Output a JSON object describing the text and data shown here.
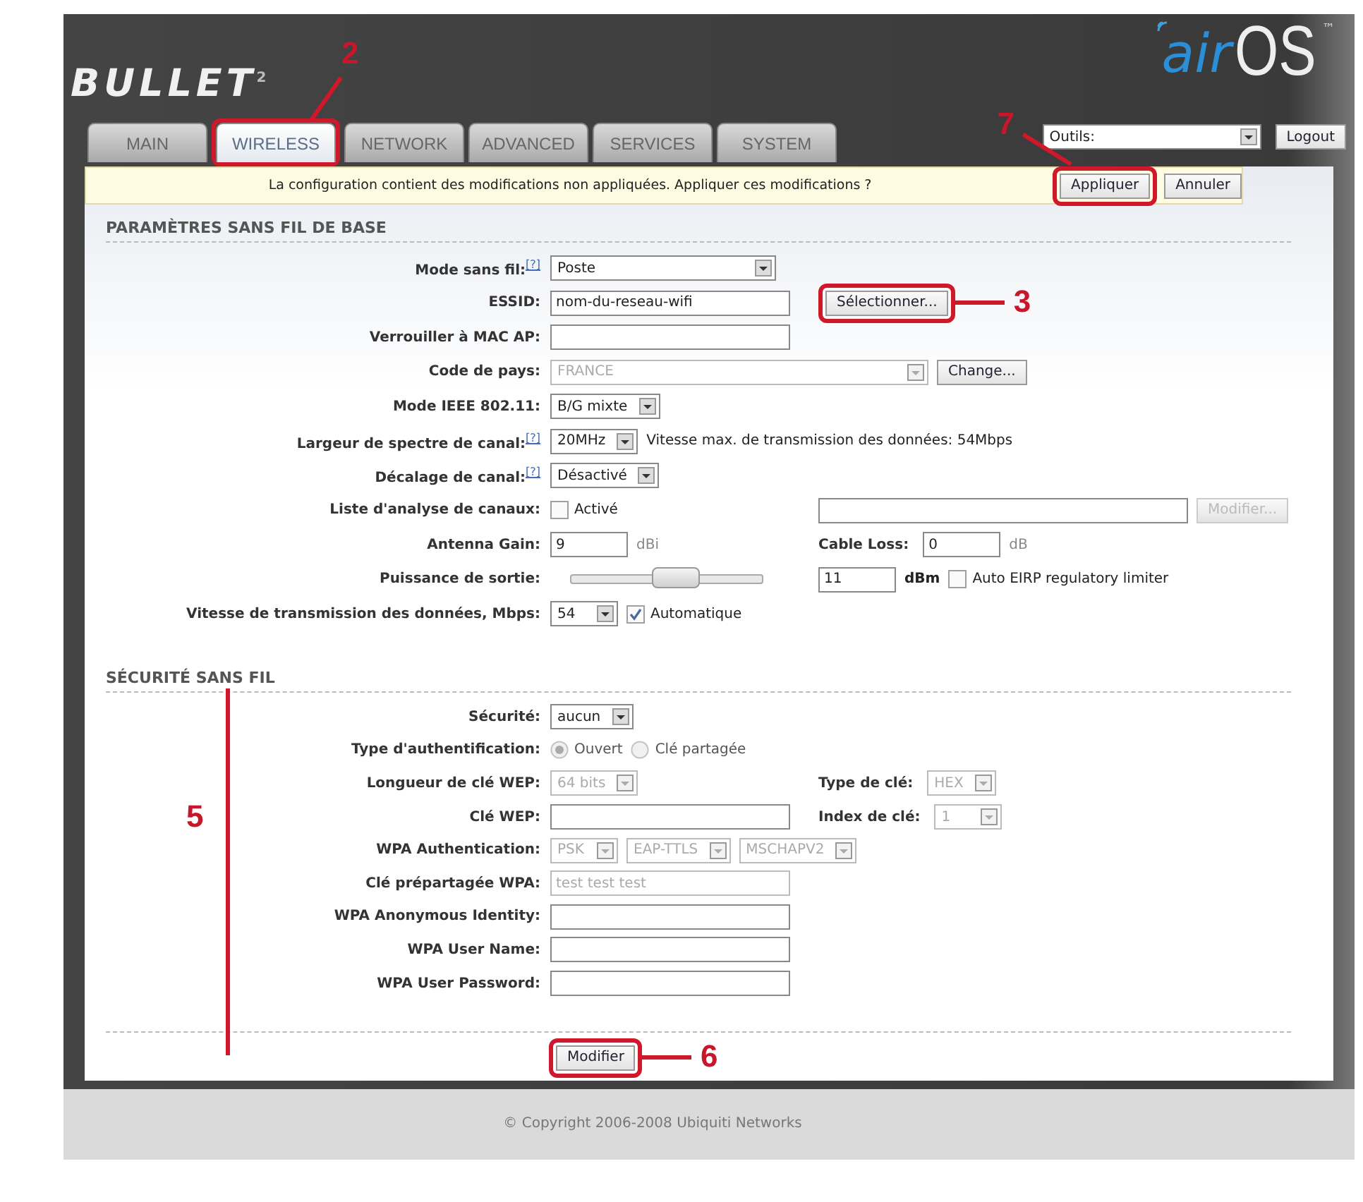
{
  "header": {
    "logo": "BULLET",
    "logo_mark": "2",
    "brand_air": "air",
    "brand_os": "OS",
    "brand_tm": "™"
  },
  "tabs": [
    {
      "label": "MAIN",
      "selected": false
    },
    {
      "label": "WIRELESS",
      "selected": true,
      "callout": "2"
    },
    {
      "label": "NETWORK",
      "selected": false
    },
    {
      "label": "ADVANCED",
      "selected": false
    },
    {
      "label": "SERVICES",
      "selected": false
    },
    {
      "label": "SYSTEM",
      "selected": false
    }
  ],
  "tools": {
    "select": "Outils:",
    "logout": "Logout"
  },
  "notice": {
    "text": "La configuration contient des modifications non appliquées. Appliquer ces modifications ?",
    "apply": "Appliquer",
    "apply_callout": "7",
    "cancel": "Annuler"
  },
  "sections": [
    {
      "title": "PARAMÈTRES SANS FIL DE BASE",
      "rows": [
        {
          "label": "Mode sans fil:",
          "help": "[?]",
          "controls": [
            {
              "kind": "select",
              "value": "Poste",
              "disabled": false,
              "wide": true
            }
          ]
        },
        {
          "label": "ESSID:",
          "controls": [
            {
              "kind": "text",
              "value": "nom-du-reseau-wifi",
              "disabled": false
            }
          ],
          "side": {
            "controls": [
              {
                "kind": "button",
                "label": "Sélectionner...",
                "disabled": false,
                "callout": "3"
              }
            ]
          }
        },
        {
          "label": "Verrouiller à MAC AP:",
          "controls": [
            {
              "kind": "text",
              "disabled": false
            }
          ]
        },
        {
          "label": "Code de pays:",
          "controls": [
            {
              "kind": "select",
              "value": "FRANCE",
              "disabled": true,
              "wide": true
            },
            {
              "kind": "button",
              "label": "Change...",
              "disabled": false
            }
          ]
        },
        {
          "label": "Mode IEEE 802.11:",
          "controls": [
            {
              "kind": "select",
              "value": "B/G mixte",
              "disabled": false
            }
          ]
        },
        {
          "label": "Largeur de spectre de canal:",
          "help": "[?]",
          "controls": [
            {
              "kind": "select",
              "value": "20MHz",
              "disabled": false
            },
            {
              "kind": "note",
              "text": "Vitesse max. de transmission des données: 54Mbps"
            }
          ]
        },
        {
          "label": "Décalage de canal:",
          "help": "[?]",
          "controls": [
            {
              "kind": "select",
              "value": "Désactivé",
              "disabled": false
            }
          ]
        },
        {
          "label": "Liste d'analyse de canaux:",
          "controls": [
            {
              "kind": "checkbox",
              "label": "Activé",
              "checked": false,
              "disabled": false
            }
          ],
          "side": {
            "controls": [
              {
                "kind": "text",
                "disabled": false,
                "wide": true
              },
              {
                "kind": "button",
                "label": "Modifier...",
                "disabled": true
              }
            ]
          }
        },
        {
          "label": "Antenna Gain:",
          "controls": [
            {
              "kind": "text",
              "value": "9",
              "disabled": false,
              "short": true
            },
            {
              "kind": "unit",
              "text": "dBi",
              "dim": true
            }
          ],
          "side": {
            "label": "Cable Loss:",
            "controls": [
              {
                "kind": "text",
                "value": "0",
                "disabled": false,
                "short": true
              },
              {
                "kind": "unit",
                "text": "dB",
                "dim": true
              }
            ]
          }
        },
        {
          "label": "Puissance de sortie:",
          "controls": [
            {
              "kind": "slider",
              "level": 0.55
            }
          ],
          "side": {
            "controls": [
              {
                "kind": "text",
                "value": "11",
                "disabled": false,
                "short": true
              },
              {
                "kind": "unit",
                "text": "dBm",
                "dim": false
              },
              {
                "kind": "checkbox",
                "label": "Auto EIRP regulatory limiter",
                "checked": false,
                "disabled": false
              }
            ]
          }
        },
        {
          "label": "Vitesse de transmission des données, Mbps:",
          "controls": [
            {
              "kind": "select",
              "value": "54",
              "disabled": false
            },
            {
              "kind": "checkbox",
              "label": "Automatique",
              "checked": true,
              "disabled": false
            }
          ]
        }
      ]
    },
    {
      "title": "SÉCURITÉ SANS FIL",
      "callout": "5",
      "rows": [
        {
          "label": "Sécurité:",
          "controls": [
            {
              "kind": "select",
              "value": "aucun",
              "disabled": false
            }
          ]
        },
        {
          "label": "Type d'authentification:",
          "controls": [
            {
              "kind": "radio",
              "label": "Ouvert",
              "selected": true,
              "disabled": true
            },
            {
              "kind": "radio",
              "label": "Clé partagée",
              "selected": false,
              "disabled": true
            }
          ]
        },
        {
          "label": "Longueur de clé WEP:",
          "controls": [
            {
              "kind": "select",
              "value": "64 bits",
              "disabled": true
            }
          ],
          "side": {
            "label": "Type de clé:",
            "controls": [
              {
                "kind": "select",
                "value": "HEX",
                "disabled": true
              }
            ]
          }
        },
        {
          "label": "Clé WEP:",
          "controls": [
            {
              "kind": "text",
              "disabled": false
            }
          ],
          "side": {
            "label": "Index de clé:",
            "controls": [
              {
                "kind": "select",
                "value": "1",
                "disabled": true
              }
            ]
          }
        },
        {
          "label": "WPA Authentication:",
          "controls": [
            {
              "kind": "select",
              "value": "PSK",
              "disabled": true
            },
            {
              "kind": "select",
              "value": "EAP-TTLS",
              "disabled": true
            },
            {
              "kind": "select",
              "value": "MSCHAPV2",
              "disabled": true
            }
          ]
        },
        {
          "label": "Clé prépartagée WPA:",
          "controls": [
            {
              "kind": "text",
              "value": "test test test",
              "disabled": true
            }
          ]
        },
        {
          "label": "WPA Anonymous Identity:",
          "controls": [
            {
              "kind": "text",
              "disabled": false
            }
          ]
        },
        {
          "label": "WPA User Name:",
          "controls": [
            {
              "kind": "text",
              "disabled": false
            }
          ]
        },
        {
          "label": "WPA User Password:",
          "controls": [
            {
              "kind": "text",
              "disabled": false
            }
          ]
        }
      ]
    }
  ],
  "submit": {
    "label": "Modifier",
    "callout": "6"
  },
  "footer": "© Copyright 2006-2008 Ubiquiti Networks"
}
